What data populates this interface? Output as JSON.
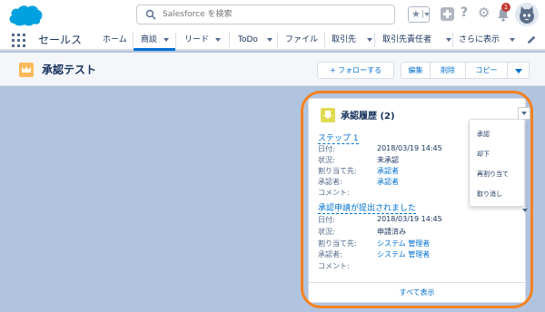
{
  "header": {
    "search_placeholder": "Salesforce を検索",
    "notification_count": "1"
  },
  "nav": {
    "app_name": "セールス",
    "items": [
      {
        "label": "ホーム"
      },
      {
        "label": "商談"
      },
      {
        "label": "リード"
      },
      {
        "label": "ToDo"
      },
      {
        "label": "ファイル"
      },
      {
        "label": "取引先"
      },
      {
        "label": "取引先責任者"
      },
      {
        "label": "さらに表示"
      }
    ]
  },
  "page": {
    "title": "承認テスト",
    "actions": {
      "follow": "+ フォローする",
      "edit": "編集",
      "delete": "削除",
      "copy": "コピー"
    }
  },
  "card": {
    "title": "承認履歴 (2)",
    "steps": [
      {
        "name": "ステップ 1",
        "fields": [
          {
            "label": "日付:",
            "value": "2018/03/19 14:45"
          },
          {
            "label": "状況:",
            "value": "未承認"
          },
          {
            "label": "割り当て先:",
            "value": "承認者"
          },
          {
            "label": "承認者:",
            "value": "承認者"
          },
          {
            "label": "コメント:",
            "value": ""
          }
        ]
      },
      {
        "name": "承認申請が提出されました",
        "fields": [
          {
            "label": "日付:",
            "value": "2018/03/19 14:45"
          },
          {
            "label": "状況:",
            "value": "申請済み"
          },
          {
            "label": "割り当て先:",
            "value": "システム 管理者"
          },
          {
            "label": "承認者:",
            "value": "システム 管理者"
          },
          {
            "label": "コメント:",
            "value": ""
          }
        ]
      }
    ],
    "footer": "すべて表示",
    "menu": [
      "承認",
      "却下",
      "再割り当て",
      "取り消し"
    ]
  },
  "colors": {
    "brand": "#00a1e0",
    "link": "#0070d2",
    "highlight": "#f58220"
  }
}
